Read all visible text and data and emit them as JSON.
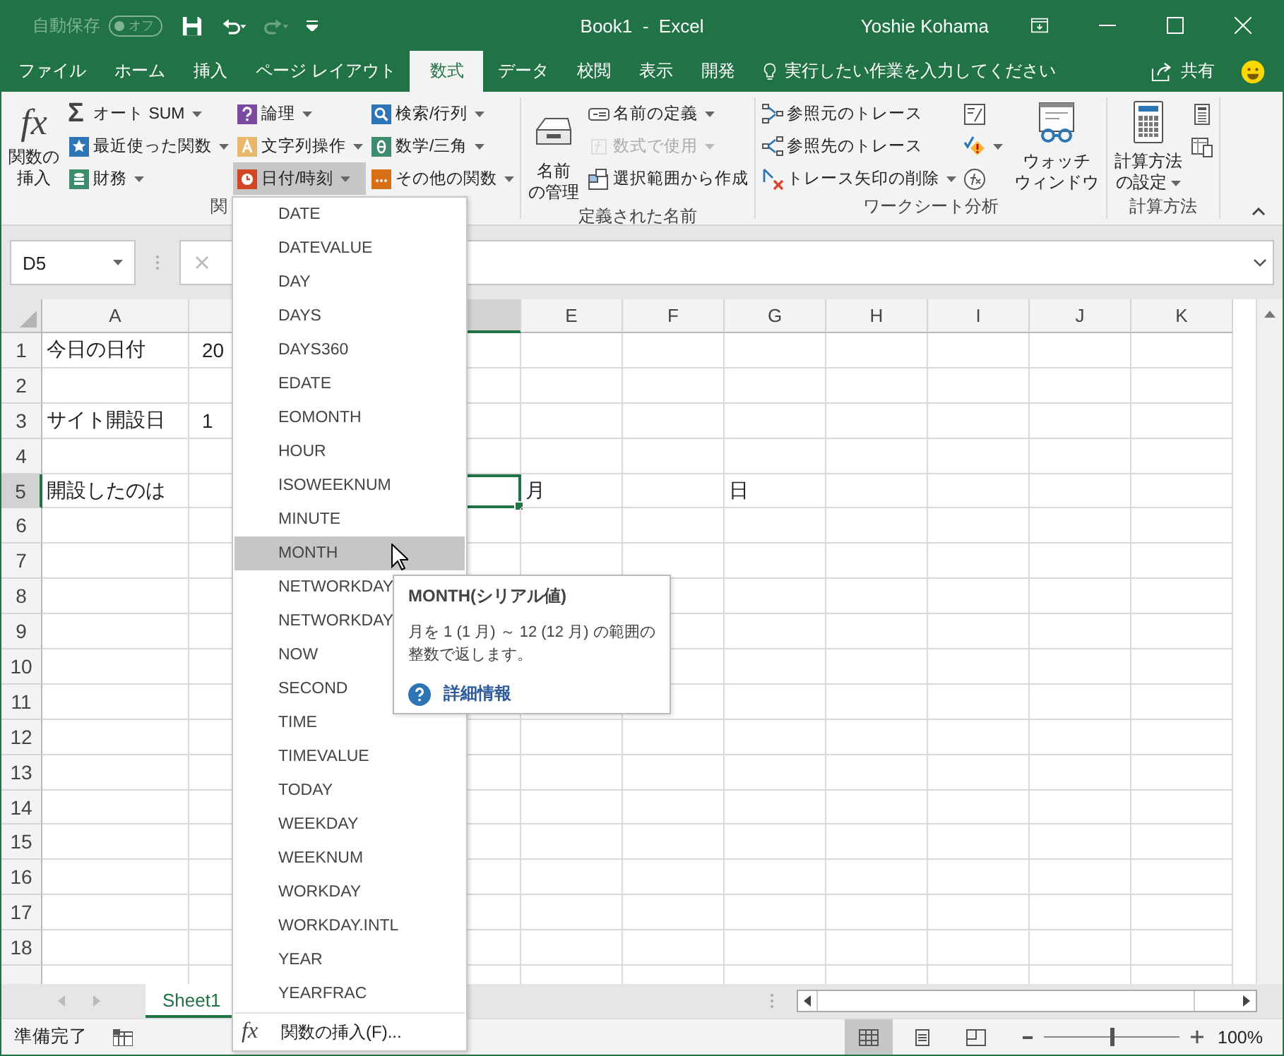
{
  "titlebar": {
    "autosave_label": "自動保存",
    "autosave_on": false,
    "autosave_state": "オフ",
    "title": "Book1  -  Excel",
    "user": "Yoshie Kohama"
  },
  "tabs": [
    {
      "label": "ファイル",
      "selected": false
    },
    {
      "label": "ホーム",
      "selected": false
    },
    {
      "label": "挿入",
      "selected": false
    },
    {
      "label": "ページ レイアウト",
      "selected": false
    },
    {
      "label": "数式",
      "selected": true
    },
    {
      "label": "データ",
      "selected": false
    },
    {
      "label": "校閲",
      "selected": false
    },
    {
      "label": "表示",
      "selected": false
    },
    {
      "label": "開発",
      "selected": false
    }
  ],
  "tell_me": "実行したい作業を入力してください",
  "share": "共有",
  "ribbon": {
    "groups": [
      {
        "label": "関",
        "items": [
          {
            "kind": "large",
            "icon_text": "fx",
            "lines": [
              "関数の",
              "挿入"
            ],
            "dropdown": false
          },
          {
            "kind": "column",
            "buttons": [
              {
                "icon_text": "Σ",
                "label": "オート SUM",
                "dropdown": true,
                "disabled": false,
                "pressed": false
              },
              {
                "label": "最近使った関数",
                "dropdown": true,
                "disabled": false,
                "pressed": false
              },
              {
                "label": "財務",
                "dropdown": true,
                "disabled": false,
                "pressed": false
              }
            ]
          },
          {
            "kind": "column",
            "buttons": [
              {
                "label": "論理",
                "dropdown": true,
                "disabled": false,
                "pressed": false
              },
              {
                "label": "文字列操作",
                "dropdown": true,
                "disabled": false,
                "pressed": false
              },
              {
                "label": "日付/時刻",
                "dropdown": true,
                "disabled": false,
                "pressed": true
              }
            ]
          },
          {
            "kind": "column",
            "buttons": [
              {
                "label": "検索/行列",
                "dropdown": true,
                "disabled": false,
                "pressed": false
              },
              {
                "label": "数学/三角",
                "dropdown": true,
                "disabled": false,
                "pressed": false
              },
              {
                "label": "その他の関数",
                "dropdown": true,
                "disabled": false,
                "pressed": false
              }
            ]
          }
        ]
      },
      {
        "label": "定義された名前",
        "items": [
          {
            "kind": "large",
            "lines": [
              "名前",
              "の管理"
            ],
            "dropdown": false
          },
          {
            "kind": "column",
            "buttons": [
              {
                "label": "名前の定義",
                "dropdown": true,
                "disabled": false,
                "pressed": false
              },
              {
                "label": "数式で使用",
                "dropdown": true,
                "disabled": true,
                "pressed": false
              },
              {
                "label": "選択範囲から作成",
                "dropdown": false,
                "disabled": false,
                "pressed": false
              }
            ]
          }
        ]
      },
      {
        "label": "ワークシート分析",
        "items": [
          {
            "kind": "column",
            "buttons": [
              {
                "label": "参照元のトレース",
                "dropdown": false,
                "disabled": false,
                "pressed": false
              },
              {
                "label": "参照先のトレース",
                "dropdown": false,
                "disabled": false,
                "pressed": false
              },
              {
                "label": "トレース矢印の削除",
                "dropdown": true,
                "disabled": false,
                "pressed": false
              }
            ]
          },
          {
            "kind": "column",
            "buttons": [
              {
                "dropdown": false,
                "disabled": false,
                "pressed": false
              },
              {
                "dropdown": true,
                "disabled": false,
                "pressed": false
              },
              {
                "dropdown": false,
                "disabled": false,
                "pressed": false
              }
            ]
          },
          {
            "kind": "large",
            "lines": [
              "ウォッチ",
              "ウィンドウ"
            ],
            "dropdown": false
          }
        ]
      },
      {
        "label": "計算方法",
        "items": [
          {
            "kind": "large",
            "lines": [
              "計算方法",
              "の設定"
            ],
            "dropdown": true
          },
          {
            "kind": "column",
            "buttons": [
              {
                "dropdown": false,
                "disabled": false,
                "pressed": false
              },
              {
                "dropdown": false,
                "disabled": false,
                "pressed": false
              }
            ]
          }
        ]
      }
    ]
  },
  "formula_bar": {
    "name_box": "D5"
  },
  "column_headers": [
    "A",
    "E",
    "F",
    "G",
    "H",
    "I",
    "J",
    "K"
  ],
  "rows": [
    {
      "number": "1",
      "A": {
        "text": "今日の日付",
        "selected": false
      },
      "B": {
        "text": "20",
        "selected": false
      }
    },
    {
      "number": "2"
    },
    {
      "number": "3",
      "A": {
        "text": "サイト開設日",
        "selected": false
      },
      "B": {
        "text": "1",
        "selected": false
      }
    },
    {
      "number": "4"
    },
    {
      "number": "5",
      "A": {
        "text": "開設したのは",
        "selected": false
      },
      "D": {
        "selected": true
      },
      "E": {
        "text": "月",
        "selected": false
      },
      "G": {
        "text": "日",
        "selected": false
      }
    },
    {
      "number": "6"
    },
    {
      "number": "7"
    },
    {
      "number": "8"
    },
    {
      "number": "9"
    },
    {
      "number": "10"
    },
    {
      "number": "11"
    },
    {
      "number": "12"
    },
    {
      "number": "13"
    },
    {
      "number": "14"
    },
    {
      "number": "15"
    },
    {
      "number": "16"
    },
    {
      "number": "17"
    },
    {
      "number": "18"
    }
  ],
  "sheet_tabs": [
    {
      "label": "Sheet1",
      "selected": true
    }
  ],
  "status_bar": {
    "text": "準備完了",
    "views": [
      {
        "selected": true
      },
      {
        "selected": false
      },
      {
        "selected": false
      }
    ],
    "zoom": {
      "level": 0.5,
      "text": "100%"
    }
  },
  "menu": {
    "items": [
      {
        "label": "DATE",
        "selected": false
      },
      {
        "label": "DATEVALUE",
        "selected": false
      },
      {
        "label": "DAY",
        "selected": false
      },
      {
        "label": "DAYS",
        "selected": false
      },
      {
        "label": "DAYS360",
        "selected": false
      },
      {
        "label": "EDATE",
        "selected": false
      },
      {
        "label": "EOMONTH",
        "selected": false
      },
      {
        "label": "HOUR",
        "selected": false
      },
      {
        "label": "ISOWEEKNUM",
        "selected": false
      },
      {
        "label": "MINUTE",
        "selected": false
      },
      {
        "label": "MONTH",
        "selected": true
      },
      {
        "label": "NETWORKDAY",
        "selected": false
      },
      {
        "label": "NETWORKDAY",
        "selected": false
      },
      {
        "label": "NOW",
        "selected": false
      },
      {
        "label": "SECOND",
        "selected": false
      },
      {
        "label": "TIME",
        "selected": false
      },
      {
        "label": "TIMEVALUE",
        "selected": false
      },
      {
        "label": "TODAY",
        "selected": false
      },
      {
        "label": "WEEKDAY",
        "selected": false
      },
      {
        "label": "WEEKNUM",
        "selected": false
      },
      {
        "label": "WORKDAY",
        "selected": false
      },
      {
        "label": "WORKDAY.INTL",
        "selected": false
      },
      {
        "label": "YEAR",
        "selected": false
      },
      {
        "label": "YEARFRAC",
        "selected": false
      }
    ],
    "footer": {
      "icon_text": "fx",
      "label": "関数の挿入(F)..."
    }
  },
  "tooltip": {
    "title": "MONTH(シリアル値)",
    "description": "月を 1 (1 月) ～ 12 (12 月) の範囲の整数で返します。",
    "link": "詳細情報"
  }
}
